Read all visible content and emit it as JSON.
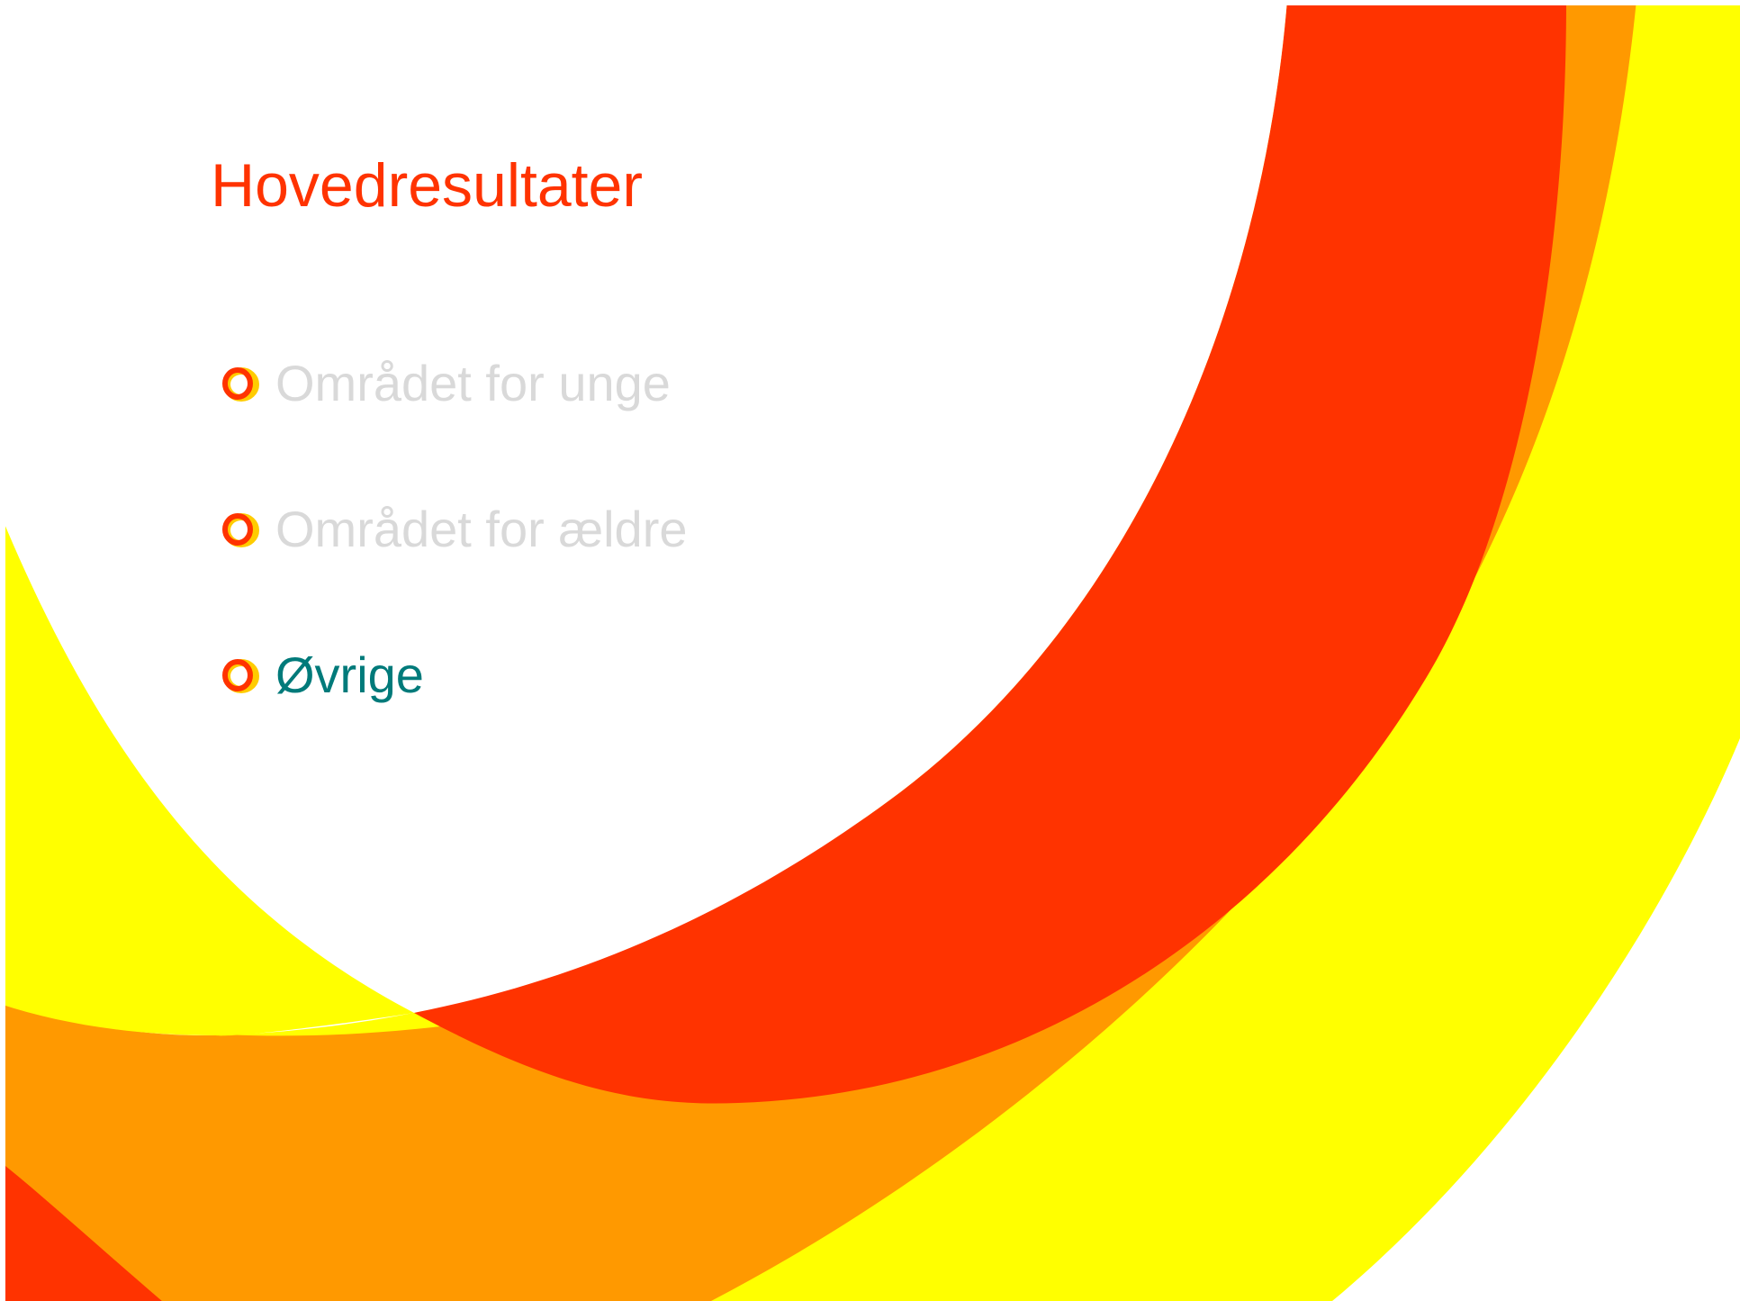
{
  "slide": {
    "title": "Hovedresultater",
    "bullets": [
      {
        "label": "Området for unge",
        "state": "inactive"
      },
      {
        "label": "Området for ældre",
        "state": "inactive"
      },
      {
        "label": "Øvrige",
        "state": "active"
      }
    ]
  },
  "colors": {
    "title": "#ff3300",
    "bullet_inactive": "#d9d9d9",
    "bullet_active": "#007a7a",
    "red": "#ff3300",
    "orange": "#ff9900",
    "yellow": "#ffff00",
    "white": "#ffffff"
  },
  "icons": {
    "bullet": "ring-bullet-icon"
  }
}
